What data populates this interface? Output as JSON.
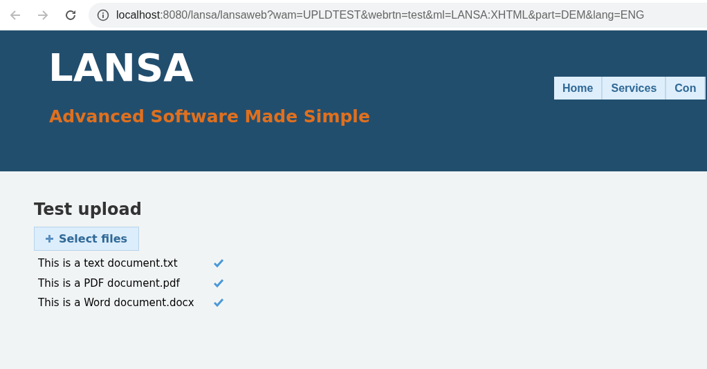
{
  "browser": {
    "url_host": "localhost",
    "url_path": ":8080/lansa/lansaweb?wam=UPLDTEST&webrtn=test&ml=LANSA:XHTML&part=DEM&lang=ENG"
  },
  "header": {
    "logo": "LANSA",
    "tagline": "Advanced Software Made Simple"
  },
  "nav": [
    {
      "label": "Home"
    },
    {
      "label": "Services"
    },
    {
      "label": "Con"
    }
  ],
  "content": {
    "title": "Test upload",
    "button": "Select files",
    "files": [
      {
        "name": "This is a text document.txt",
        "uploaded": true
      },
      {
        "name": "This is a PDF document.pdf",
        "uploaded": true
      },
      {
        "name": "This is a Word document.docx",
        "uploaded": true
      }
    ]
  }
}
